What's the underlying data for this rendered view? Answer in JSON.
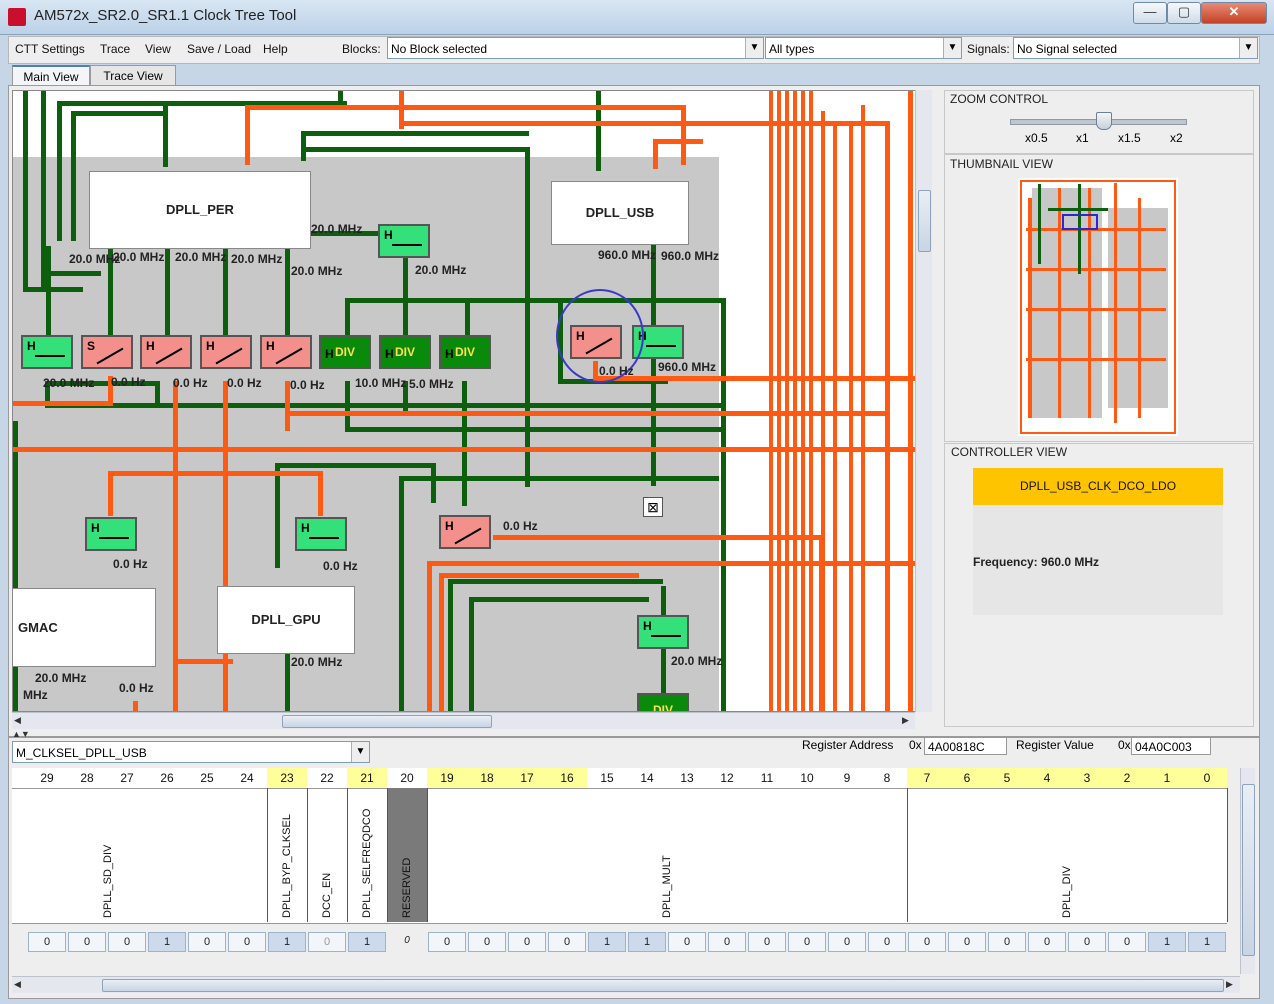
{
  "window": {
    "title": "AM572x_SR2.0_SR1.1 Clock Tree Tool",
    "minimize": "—",
    "maximize": "▢",
    "close": "✕"
  },
  "menu": [
    "CTT Settings",
    "Trace",
    "View",
    "Save / Load",
    "Help"
  ],
  "filters": {
    "blocks_label": "Blocks:",
    "blocks_value": "No Block selected",
    "types_value": "All types",
    "signals_label": "Signals:",
    "signals_value": "No Signal selected"
  },
  "tabs": [
    "Main View",
    "Trace View"
  ],
  "diagram": {
    "blocks": [
      "DPLL_PER",
      "DPLL_USB",
      "GMAC",
      "DPLL_GPU"
    ],
    "gate_h": "H",
    "gate_s": "S",
    "gate_div": "DIV",
    "freqs": {
      "per_out": "20.0 MHz",
      "per_a": "20.0 MHz",
      "per_b": "20.0 MHz",
      "per_c": "20.0 MHz",
      "per_d": "20.0 MHz",
      "per_e": "20.0 MHz",
      "per_gate": "20.0 MHz",
      "usb_a": "960.0 MHz",
      "usb_b": "960.0 MHz",
      "row1_a": "20.0 MHz",
      "row1_b": "0.0 Hz",
      "row1_c": "0.0 Hz",
      "row1_d": "0.0 Hz",
      "row1_e": "0.0 Hz",
      "row1_f": "10.0 MHz",
      "row1_g": "5.0 MHz",
      "row1_h": "0.0 Hz",
      "row1_i": "960.0 MHz",
      "g_left": "0.0 Hz",
      "g_mid": "0.0 Hz",
      "g_right": "0.0 Hz",
      "gmac_a": "20.0 MHz",
      "gmac_b": "0.0 Hz",
      "gmac_c": "MHz",
      "gpu": "20.0 MHz",
      "low_right": "20.0 MHz"
    }
  },
  "zoom": {
    "title": "ZOOM CONTROL",
    "ticks": [
      "x0.5",
      "x1",
      "x1.5",
      "x2"
    ]
  },
  "thumbnail": {
    "title": "THUMBNAIL VIEW"
  },
  "controller": {
    "title": "CONTROLLER VIEW",
    "name": "DPLL_USB_CLK_DCO_LDO",
    "frequency": "Frequency: 960.0 MHz"
  },
  "register": {
    "name": "M_CLKSEL_DPLL_USB",
    "addr_label": "Register Address",
    "addr_prefix": "0x",
    "addr_value": "4A00818C",
    "val_label": "Register Value",
    "val_prefix": "0x",
    "val_value": "04A0C003",
    "bits": [
      "29",
      "28",
      "27",
      "26",
      "25",
      "24",
      "23",
      "22",
      "21",
      "20",
      "19",
      "18",
      "17",
      "16",
      "15",
      "14",
      "13",
      "12",
      "11",
      "10",
      "9",
      "8",
      "7",
      "6",
      "5",
      "4",
      "3",
      "2",
      "1",
      "0"
    ],
    "fields": [
      "DPLL_SD_DIV",
      "DPLL_BYP_CLKSEL",
      "DCC_EN",
      "DPLL_SELFREQDCO",
      "RESERVED",
      "DPLL_MULT",
      "DPLL_DIV"
    ],
    "values": [
      "0",
      "0",
      "0",
      "1",
      "0",
      "0",
      "1",
      "0",
      "1",
      "0",
      "0",
      "0",
      "0",
      "0",
      "1",
      "1",
      "0",
      "0",
      "0",
      "0",
      "0",
      "0",
      "0",
      "0",
      "0",
      "0",
      "0",
      "0",
      "1",
      "1"
    ]
  }
}
